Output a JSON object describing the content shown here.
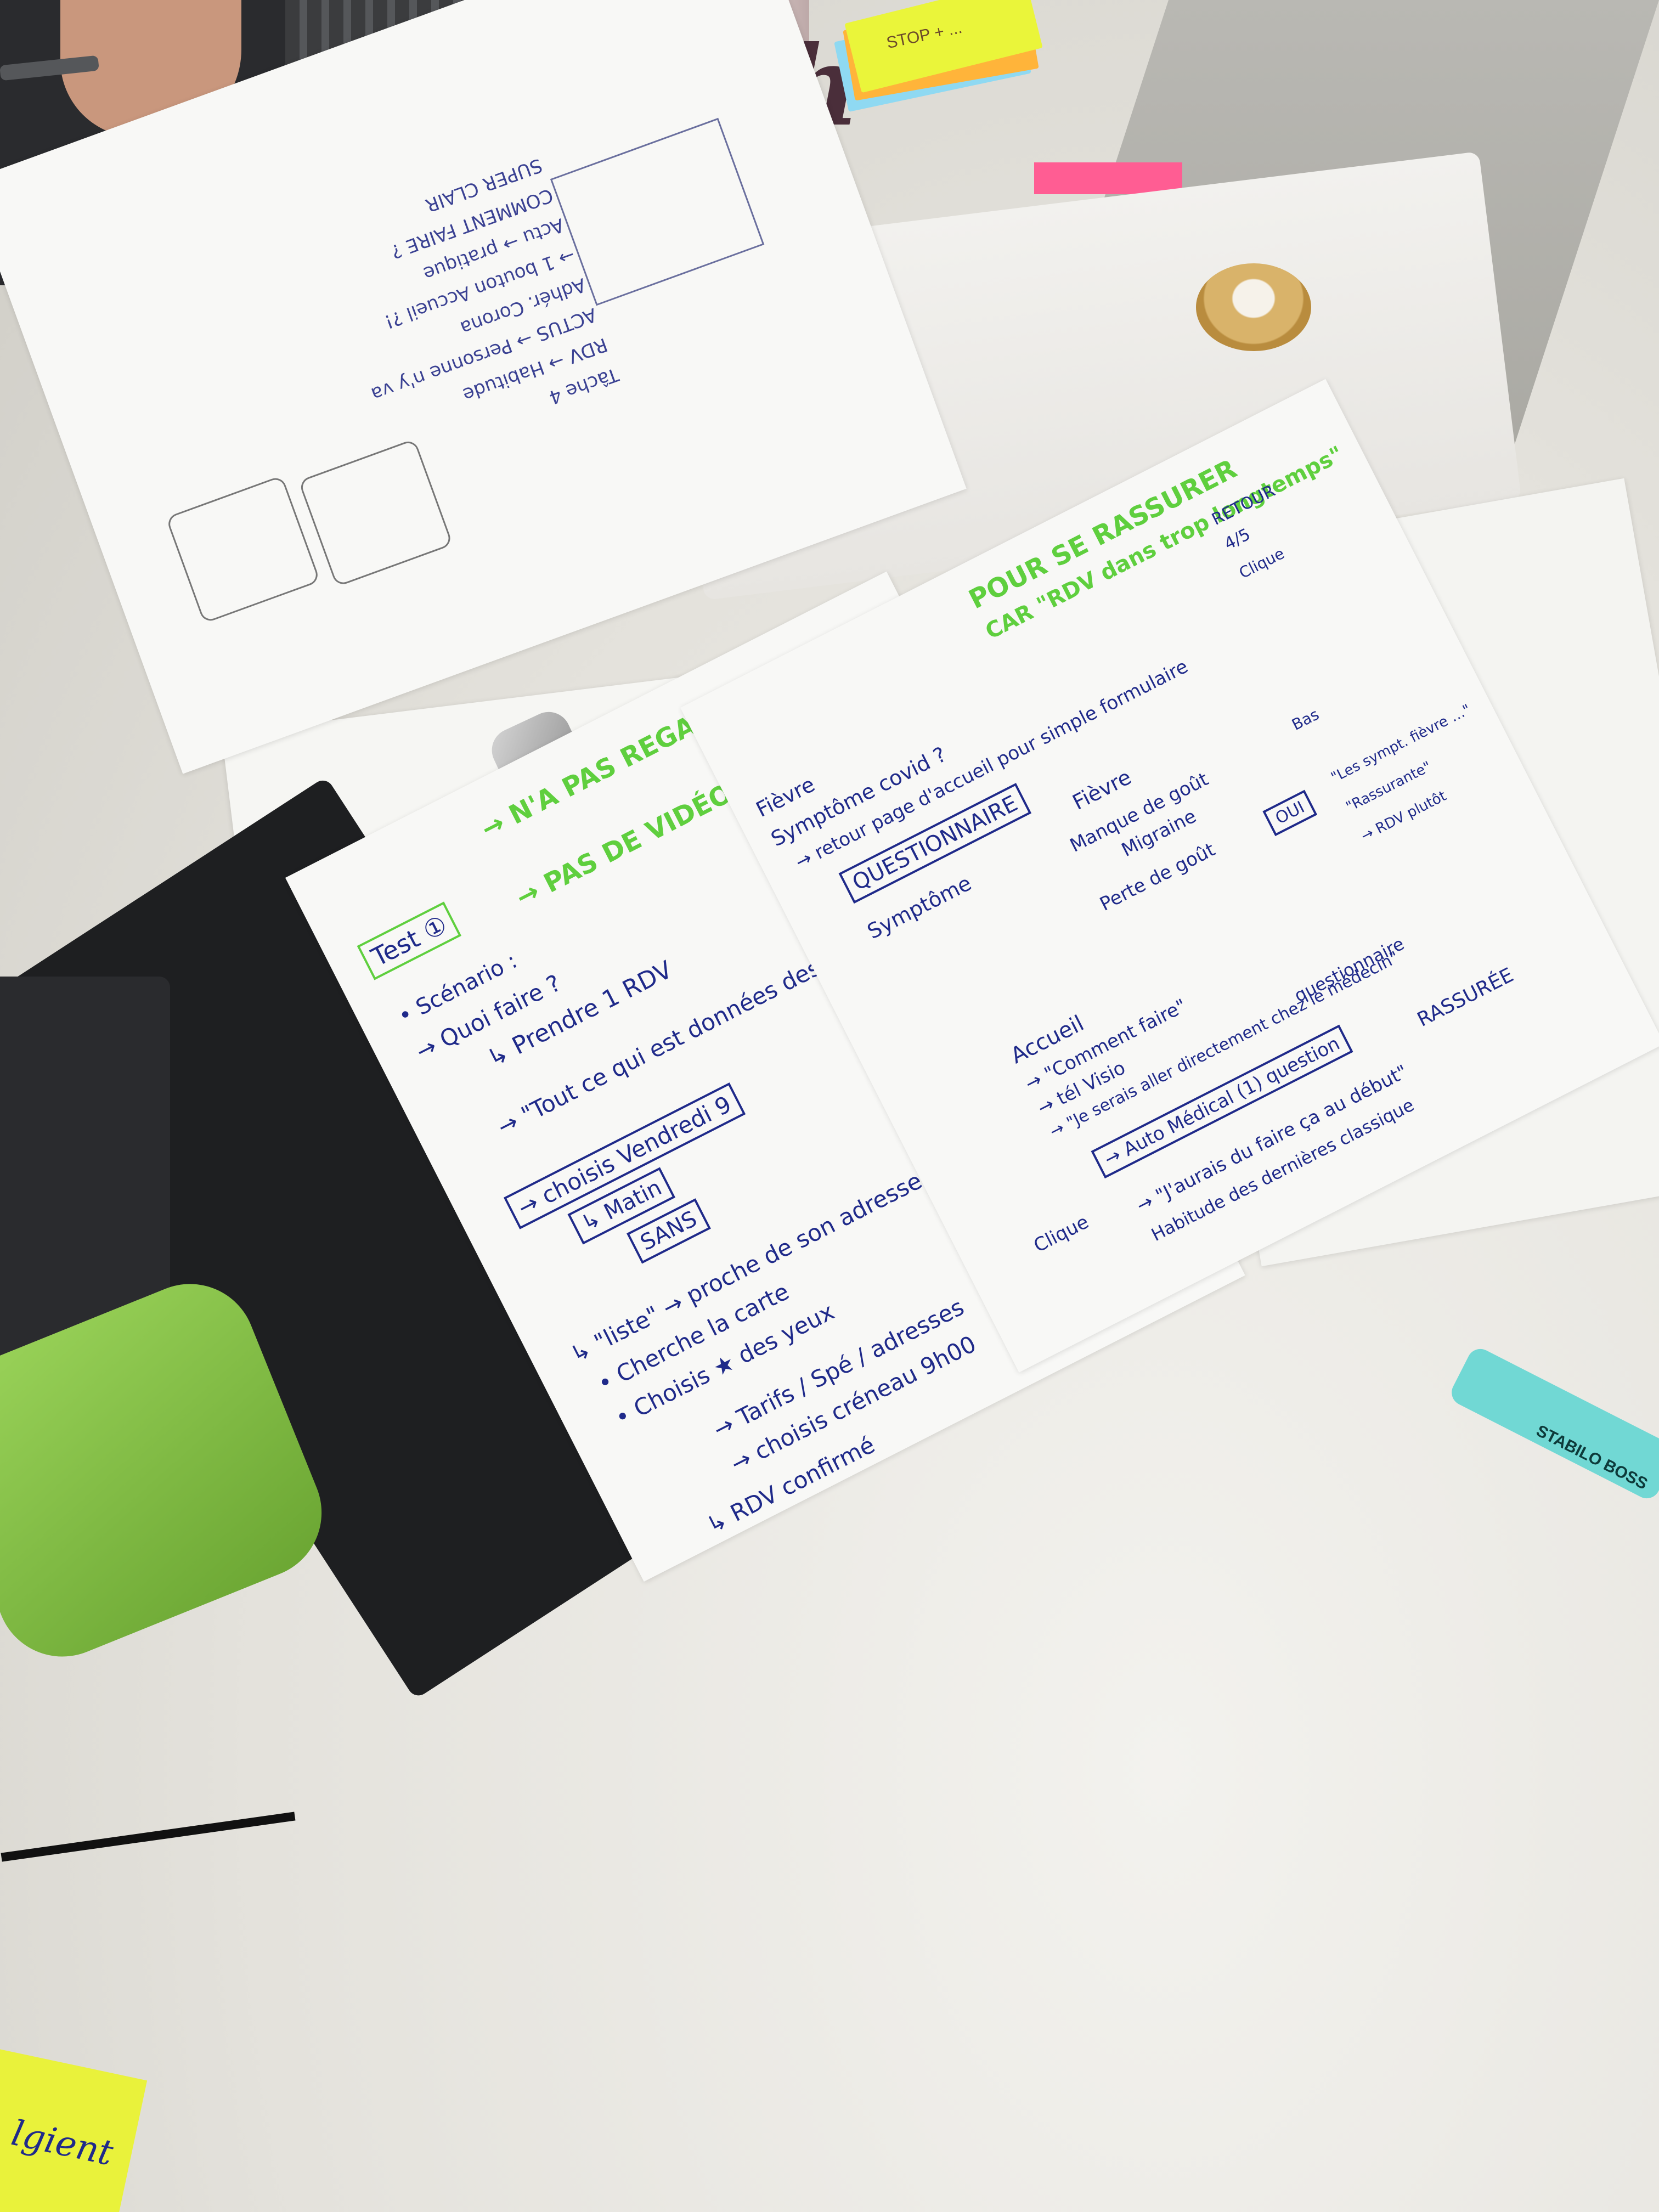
{
  "scene": {
    "bottle_text": "th",
    "sticky_label": "STOP + ...",
    "highlighter_label": "STABILO BOSS",
    "yellow_note_text": "lgient"
  },
  "top_sheet": {
    "lines": [
      "Tâche 4",
      "RDV → Habitude",
      "ACTUS → Personne n'y va",
      "Adhér. Corona",
      "→ 1 bouton   Accueil ?!",
      "Actu → pratique",
      "COMMENT FAIRE ?",
      "SUPER CLAIR"
    ]
  },
  "left_sheet": {
    "tag": "Test ①",
    "green_notes": [
      "→ N'A PAS REGARDÉ LES ACTUS",
      "→ PAS DE VIDÉO OU CHAT"
    ],
    "lines": [
      "• Scénario :",
      "→ Quoi faire ?",
      "↳ Prendre 1 RDV",
      "→ \"Tout ce qui est données des médecins\"",
      "→ choisis Vendredi 9",
      "↳ Matin",
      "SANS",
      "↳ \"liste\" → proche de son adresse",
      "• Cherche la carte",
      "• Choisis ★ des yeux",
      "→ Tarifs / Spé / adresses",
      "→ choisis créneau 9h00",
      "↳ RDV confirmé"
    ]
  },
  "right_sheet": {
    "green_notes": [
      "POUR SE RASSURER",
      "CAR \"RDV dans trop longtemps\""
    ],
    "lines": [
      "Fièvre",
      "Symptôme covid ?",
      "→ retour page d'accueil pour simple formulaire",
      "QUESTIONNAIRE",
      "Symptôme",
      "Fièvre",
      "Manque de goût",
      "Migraine",
      "Perte de goût",
      "OUI",
      "Accueil",
      "→ \"Comment faire\"",
      "→ tél Visio",
      "→ \"Je serais aller directement chez le médecin\"",
      "→ Auto Médical (1) question",
      "Clique",
      "→ \"J'aurais du faire ça au début\"",
      "Habitude des dernières classique",
      "RETOUR",
      "4/5",
      "Clique",
      "Bas",
      "questionnaire",
      "RASSURÉE",
      "\"Les sympt. fièvre …\"",
      "\"Rassurante\"",
      "→ RDV plutôt"
    ]
  }
}
